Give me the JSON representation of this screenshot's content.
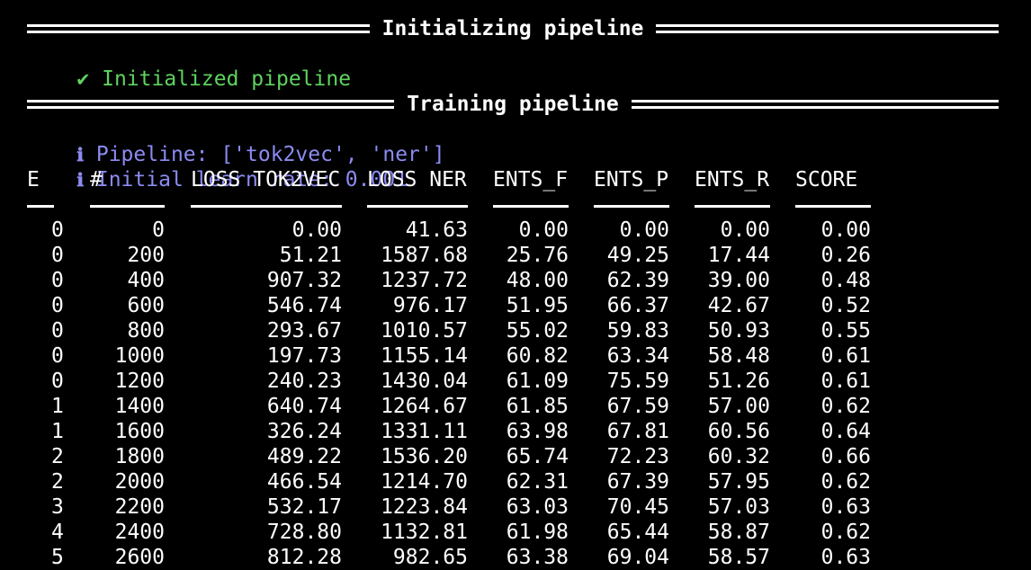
{
  "headers": {
    "init": "Initializing pipeline",
    "train": "Training pipeline"
  },
  "messages": {
    "initialized": "Initialized pipeline",
    "pipeline": "Pipeline: ['tok2vec', 'ner']",
    "learn_rate": "Initial learn rate: 0.001"
  },
  "icons": {
    "check": "check-icon",
    "info": "info-icon"
  },
  "colors": {
    "background": "#000000",
    "text": "#ffffff",
    "success": "#5fd35f",
    "info": "#8b8bf2"
  },
  "table": {
    "columns": [
      "E",
      "#",
      "LOSS TOK2VEC",
      "LOSS NER",
      "ENTS_F",
      "ENTS_P",
      "ENTS_R",
      "SCORE"
    ],
    "rows": [
      [
        "0",
        "0",
        "0.00",
        "41.63",
        "0.00",
        "0.00",
        "0.00",
        "0.00"
      ],
      [
        "0",
        "200",
        "51.21",
        "1587.68",
        "25.76",
        "49.25",
        "17.44",
        "0.26"
      ],
      [
        "0",
        "400",
        "907.32",
        "1237.72",
        "48.00",
        "62.39",
        "39.00",
        "0.48"
      ],
      [
        "0",
        "600",
        "546.74",
        "976.17",
        "51.95",
        "66.37",
        "42.67",
        "0.52"
      ],
      [
        "0",
        "800",
        "293.67",
        "1010.57",
        "55.02",
        "59.83",
        "50.93",
        "0.55"
      ],
      [
        "0",
        "1000",
        "197.73",
        "1155.14",
        "60.82",
        "63.34",
        "58.48",
        "0.61"
      ],
      [
        "0",
        "1200",
        "240.23",
        "1430.04",
        "61.09",
        "75.59",
        "51.26",
        "0.61"
      ],
      [
        "1",
        "1400",
        "640.74",
        "1264.67",
        "61.85",
        "67.59",
        "57.00",
        "0.62"
      ],
      [
        "1",
        "1600",
        "326.24",
        "1331.11",
        "63.98",
        "67.81",
        "60.56",
        "0.64"
      ],
      [
        "2",
        "1800",
        "489.22",
        "1536.20",
        "65.74",
        "72.23",
        "60.32",
        "0.66"
      ],
      [
        "2",
        "2000",
        "466.54",
        "1214.70",
        "62.31",
        "67.39",
        "57.95",
        "0.62"
      ],
      [
        "3",
        "2200",
        "532.17",
        "1223.84",
        "63.03",
        "70.45",
        "57.03",
        "0.63"
      ],
      [
        "4",
        "2400",
        "728.80",
        "1132.81",
        "61.98",
        "65.44",
        "58.87",
        "0.62"
      ],
      [
        "5",
        "2600",
        "812.28",
        "982.65",
        "63.38",
        "69.04",
        "58.57",
        "0.63"
      ]
    ]
  }
}
